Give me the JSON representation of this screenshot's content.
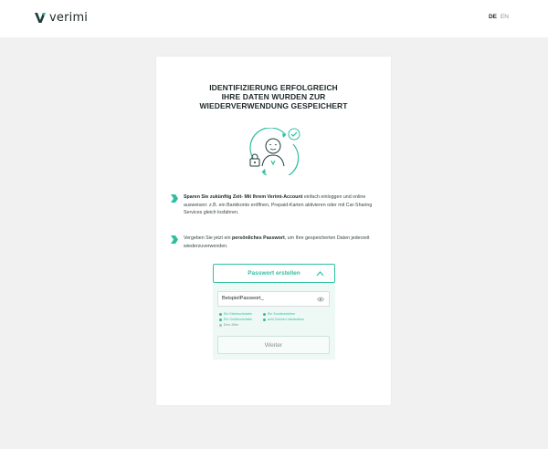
{
  "header": {
    "brand_name": "verimi",
    "languages": [
      {
        "code": "DE",
        "active": true
      },
      {
        "code": "EN",
        "active": false
      }
    ]
  },
  "card": {
    "title_lines": [
      "IDENTIFIZIERUNG ERFOLGREICH",
      "IHRE DATEN WURDEN ZUR",
      "WIEDERVERWENDUNG GESPEICHERT"
    ],
    "illustration": "user-with-lock-and-check-icon",
    "bullets": [
      {
        "strong": "Sparen Sie zukünftig Zeit- Mit Ihrem Verimi-Account",
        "text": " einfach einloggen und online ausweisen: z.B. ein Bankkonto eröffnen, Prepaid-Karten aktivieren oder mit Car-Sharing Services gleich losfahren."
      },
      {
        "prefix": "Vergeben Sie jetzt ein ",
        "strong": "persönliches Passwort",
        "text": ", um Ihre gespeicherten Daten jederzeit wiederzuverwenden."
      }
    ]
  },
  "password": {
    "toggle_label": "Passwort erstellen",
    "input_value": "BeispielPasswort_",
    "requirements": [
      {
        "label": "Ein Kleinbuchstabe",
        "met": true
      },
      {
        "label": "Ein Sonderzeichen",
        "met": true
      },
      {
        "label": "Ein Großbuchstabe",
        "met": true
      },
      {
        "label": "acht Zeichen mindestens",
        "met": true
      },
      {
        "label": "Eine Ziffer",
        "met": false
      }
    ],
    "submit_label": "Weiter"
  },
  "colors": {
    "accent": "#2fbf9f",
    "background": "#f1f1f1",
    "text": "#1e2a2a"
  }
}
